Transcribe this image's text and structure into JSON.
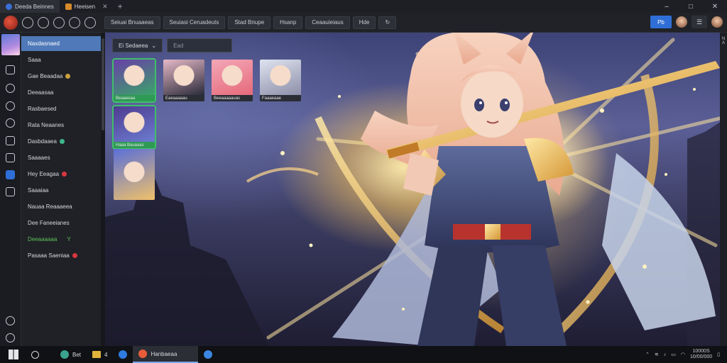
{
  "window": {
    "tabs": [
      {
        "label": "Deeda Beinnes",
        "icon": "browser-icon"
      },
      {
        "label": "Heeisen",
        "icon": "app-icon"
      }
    ],
    "new_tab": "+",
    "controls": {
      "minimize": "–",
      "maximize": "□",
      "close": "✕"
    }
  },
  "toolbar": {
    "pills": [
      "Seiuai Bnuaaeas",
      "Seuiasi Ceruadeuts",
      "Stad Bnupe",
      "Hsanp",
      "Ceaauieiaus",
      "Hde"
    ],
    "refresh": "↻",
    "primary_label": "Pb"
  },
  "nav": {
    "items": [
      {
        "label": "Naxdasnaed",
        "active": true
      },
      {
        "label": "Saaa"
      },
      {
        "label": "Gae Beaadaa",
        "badge": "#c9a23a"
      },
      {
        "label": "Deeaasaa"
      },
      {
        "label": "Rasbaesed"
      },
      {
        "label": "Rata Neaanes"
      },
      {
        "label": "Dasbdaaea",
        "badge": "#3fb68a"
      },
      {
        "label": "Saaaaes"
      },
      {
        "label": "Hey Eeagaa",
        "badge": "#d9373f"
      },
      {
        "label": "Saaaiaa"
      },
      {
        "label": "Nauaa Reaaaeea"
      },
      {
        "label": "Dee Faneeianes"
      },
      {
        "label": "Deeaaaaaa",
        "green": true,
        "suffix": "Y"
      },
      {
        "label": "Pasaaa Saeniaa",
        "badge": "#d9373f"
      }
    ]
  },
  "filters": {
    "sort_label": "Ei Sedaeea",
    "search_value": "Ead"
  },
  "thumbnails": [
    {
      "label": "Beaaeeaa",
      "selected": true
    },
    {
      "label": "Eaeaaaaau"
    },
    {
      "label": "Beeaaaaauas"
    },
    {
      "label": "Faaaeaae"
    },
    {
      "label": "Haaa Bauaaas",
      "selected": true
    },
    {
      "label": ""
    }
  ],
  "scroll_label": "N\nA",
  "taskbar": {
    "apps": [
      {
        "label": "Bet"
      },
      {
        "label": "4"
      },
      {
        "label": ""
      },
      {
        "label": "Hanbaeaa",
        "active": true
      },
      {
        "label": ""
      }
    ],
    "clock_time": "10000S",
    "clock_date": "10/00/000"
  },
  "colors": {
    "accent": "#2f6ed6",
    "nav_active": "#4f79b8",
    "selected_green": "#3fbf6a"
  }
}
